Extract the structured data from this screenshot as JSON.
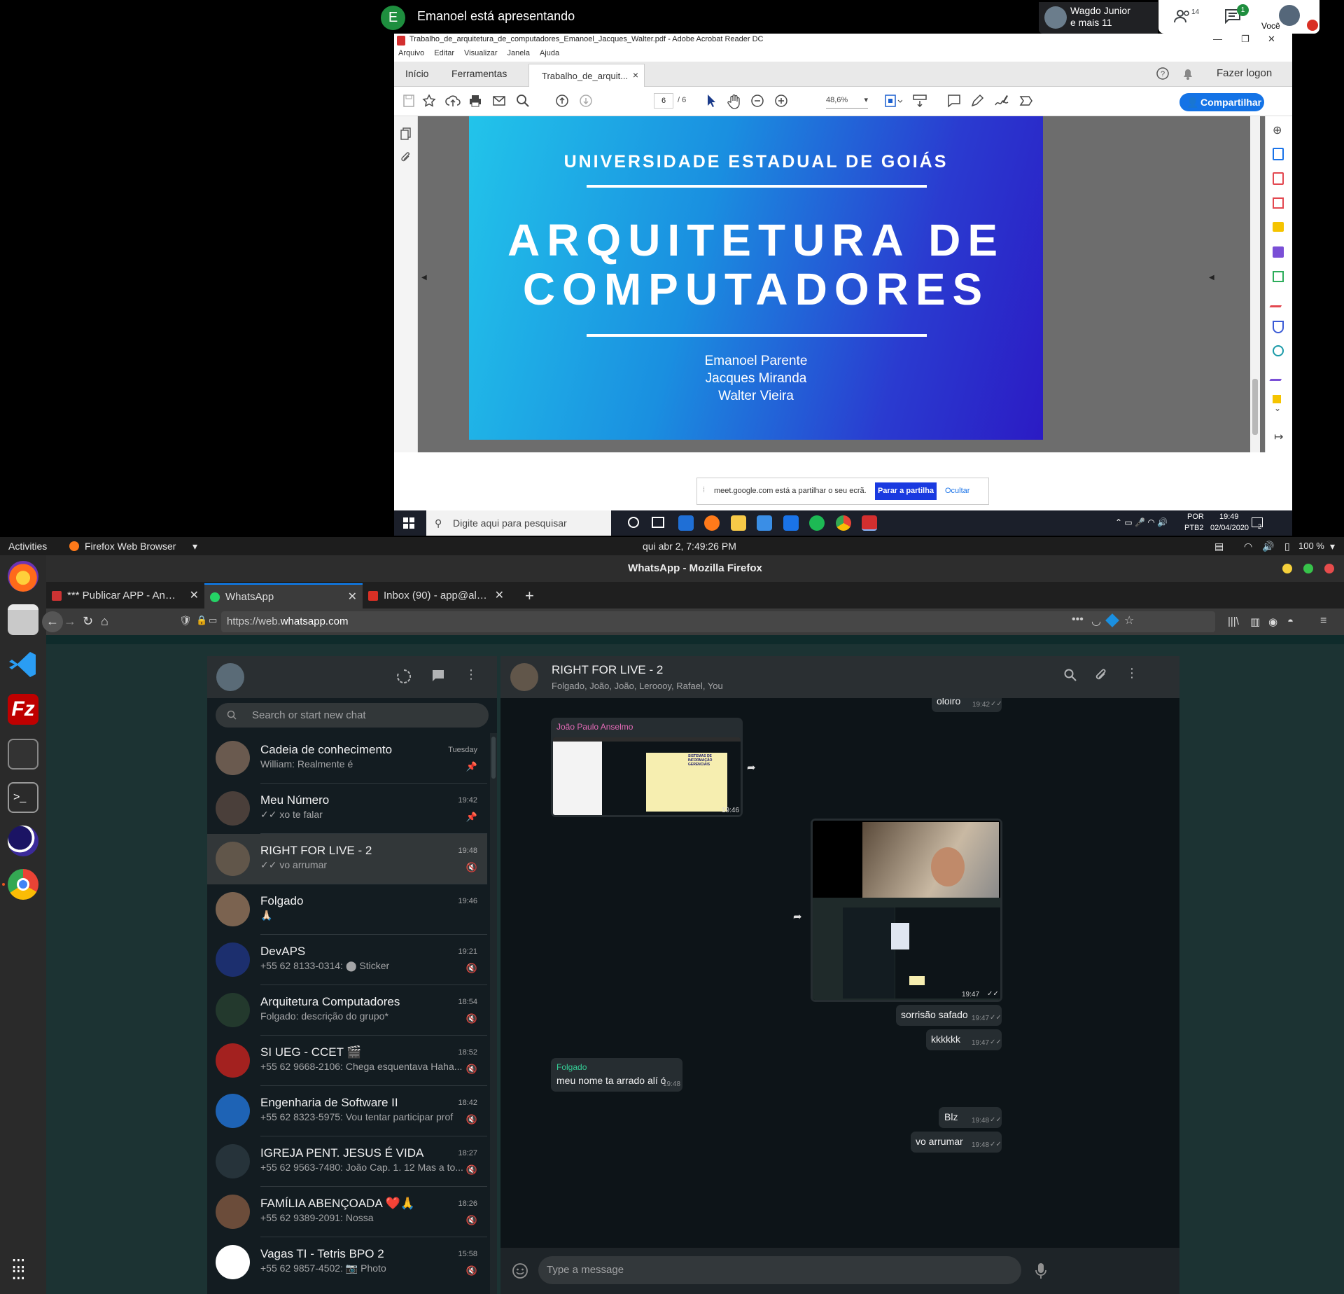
{
  "meet": {
    "presenter_initial": "E",
    "presenter_text": "Emanoel está apresentando",
    "participants_name": "Wagdo Junior",
    "participants_more": "e mais 11",
    "people_count": "14",
    "chat_count": "1",
    "self_label": "Você"
  },
  "acrobat": {
    "window_title": "Trabalho_de_arquitetura_de_computadores_Emanoel_Jacques_Walter.pdf - Adobe Acrobat Reader DC",
    "menu": [
      "Arquivo",
      "Editar",
      "Visualizar",
      "Janela",
      "Ajuda"
    ],
    "tabs": {
      "home": "Início",
      "tools": "Ferramentas",
      "doc": "Trabalho_de_arquit..."
    },
    "login": "Fazer logon",
    "page_current": "6",
    "page_total": "/ 6",
    "zoom": "48,6%",
    "share_label": "Compartilhar",
    "slide": {
      "university": "UNIVERSIDADE ESTADUAL DE GOIÁS",
      "title_line1": "ARQUITETURA DE",
      "title_line2": "COMPUTADORES",
      "authors": [
        "Emanoel Parente",
        "Jacques Miranda",
        "Walter  Vieira"
      ]
    },
    "share_notice": {
      "text": "meet.google.com está a partilhar o seu ecrã.",
      "stop": "Parar a partilha",
      "hide": "Ocultar"
    }
  },
  "windows_taskbar": {
    "search_placeholder": "Digite aqui para pesquisar",
    "lang1": "POR",
    "lang2": "PTB2",
    "time": "19:49",
    "date": "02/04/2020",
    "notif_count": "2"
  },
  "gnome": {
    "activities": "Activities",
    "app_menu": "Firefox Web Browser",
    "clock": "qui abr  2,  7:49:26 PM",
    "battery": "100 %"
  },
  "firefox": {
    "window_title": "WhatsApp - Mozilla Firefox",
    "tabs": [
      {
        "label": "*** Publicar APP - Andro",
        "active": false
      },
      {
        "label": "WhatsApp",
        "active": true
      },
      {
        "label": "Inbox (90) - app@aldeiav",
        "active": false
      }
    ],
    "url_prefix": "https://web.",
    "url_domain": "whatsapp.com"
  },
  "whatsapp": {
    "search_placeholder": "Search or start new chat",
    "chats": [
      {
        "name": "Cadeia de conhecimento",
        "preview": "William: Realmente é",
        "time": "Tuesday",
        "status": "pinned"
      },
      {
        "name": "Meu Número",
        "preview": "✓✓ xo te falar",
        "time": "19:42",
        "status": "pinned"
      },
      {
        "name": "RIGHT FOR LIVE - 2",
        "preview": "✓✓ vo arrumar",
        "time": "19:48",
        "status": "muted"
      },
      {
        "name": "Folgado",
        "preview": "🙏🏻",
        "time": "19:46",
        "status": ""
      },
      {
        "name": "DevAPS",
        "preview": "+55 62 8133-0314: ⬤ Sticker",
        "time": "19:21",
        "status": "muted"
      },
      {
        "name": "Arquitetura Computadores",
        "preview": "Folgado: descrição do grupo*",
        "time": "18:54",
        "status": "muted"
      },
      {
        "name": "SI UEG - CCET 🎬",
        "preview": "+55 62 9668-2106: Chega esquentava Haha...",
        "time": "18:52",
        "status": "muted"
      },
      {
        "name": "Engenharia de Software II",
        "preview": "+55 62 8323-5975: Vou tentar participar prof",
        "time": "18:42",
        "status": "muted"
      },
      {
        "name": "IGREJA PENT. JESUS É VIDA",
        "preview": "+55 62 9563-7480: João Cap. 1. 12 Mas a to...",
        "time": "18:27",
        "status": "muted"
      },
      {
        "name": "FAMÍLIA ABENÇOADA ❤️🙏",
        "preview": "+55 62 9389-2091: Nossa",
        "time": "18:26",
        "status": "muted"
      },
      {
        "name": "Vagas TI - Tetris BPO 2",
        "preview": "+55 62 9857-4502: 📷 Photo",
        "time": "15:58",
        "status": "muted"
      }
    ],
    "conversation": {
      "name": "RIGHT FOR LIVE - 2",
      "members": "Folgado, João, João, Leroooy, Rafael, You",
      "messages": [
        {
          "dir": "out",
          "text": "oloiro",
          "time": "19:42"
        },
        {
          "dir": "in",
          "sender": "João Paulo Anselmo",
          "type": "image",
          "caption_title": "SISTEMAS DE INFORMAÇÃO GERENCIAIS",
          "time": "19:46"
        },
        {
          "dir": "out",
          "type": "image",
          "time": "19:47"
        },
        {
          "dir": "out",
          "text": "sorrisão safado",
          "time": "19:47"
        },
        {
          "dir": "out",
          "text": "kkkkkk",
          "time": "19:47"
        },
        {
          "dir": "in",
          "sender": "Folgado",
          "text": "meu nome ta arrado alí ó",
          "time": "19:48"
        },
        {
          "dir": "out",
          "text": "Blz",
          "time": "19:48"
        },
        {
          "dir": "out",
          "text": "vo arrumar",
          "time": "19:48"
        }
      ]
    },
    "composer_placeholder": "Type a message",
    "colors": {
      "sender1": "#e26ab6",
      "sender2": "#35cd96",
      "accent": "#0a84ff"
    }
  }
}
